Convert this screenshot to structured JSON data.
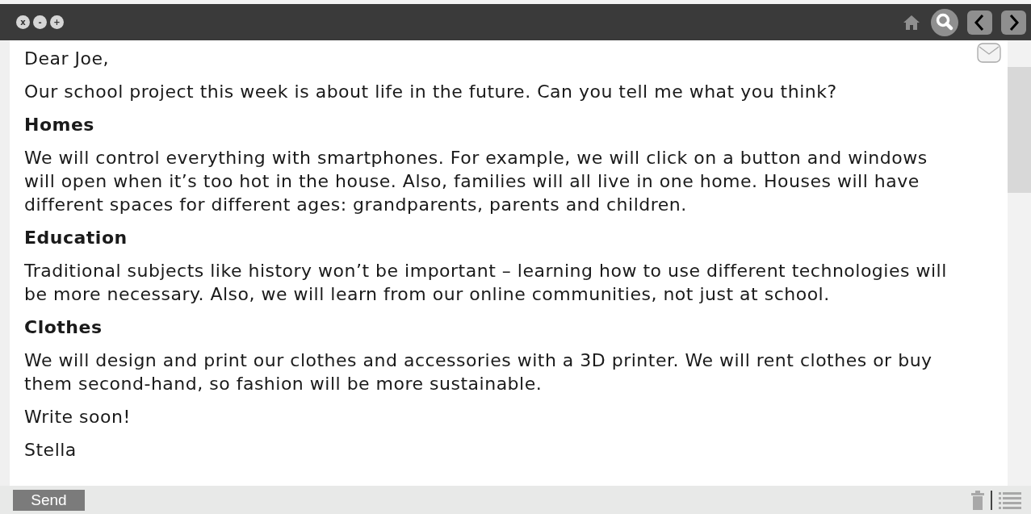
{
  "window": {
    "controls": [
      {
        "label": "x"
      },
      {
        "label": "-"
      },
      {
        "label": "+"
      }
    ]
  },
  "email": {
    "blocks": [
      {
        "kind": "paragraph",
        "text": "Dear Joe,"
      },
      {
        "kind": "paragraph",
        "text": "Our school project this week is about life in the future. Can you tell me what you think?"
      },
      {
        "kind": "heading",
        "text": "Homes"
      },
      {
        "kind": "paragraph",
        "text": "We will control everything with smartphones. For example, we will click on a button and windows will open when it’s too hot in the house. Also, families will all live in one home. Houses will have different spaces for different ages: grandparents, parents and children."
      },
      {
        "kind": "heading",
        "text": "Education"
      },
      {
        "kind": "paragraph",
        "text": "Traditional subjects like history won’t be important – learning how to use different technologies will be more necessary. Also, we will learn from our online communities, not just at school."
      },
      {
        "kind": "heading",
        "text": "Clothes"
      },
      {
        "kind": "paragraph",
        "text": "We will design and print our clothes and accessories with a 3D printer. We will rent clothes or buy them second-hand, so fashion will be more sustainable."
      },
      {
        "kind": "paragraph",
        "text": "Write soon!"
      },
      {
        "kind": "paragraph",
        "text": "Stella"
      }
    ]
  },
  "footer": {
    "send_button": "Send"
  }
}
